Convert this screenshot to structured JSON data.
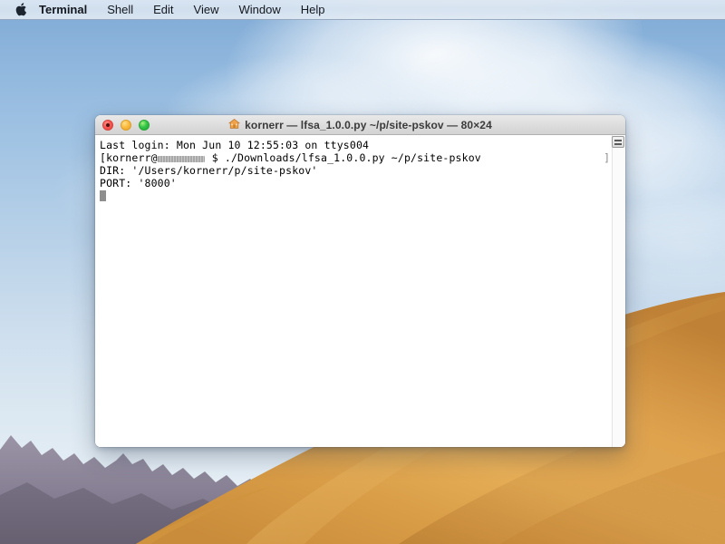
{
  "menubar": {
    "apple_icon": "apple-logo-icon",
    "items": [
      {
        "label": "Terminal",
        "bold": true
      },
      {
        "label": "Shell",
        "bold": false
      },
      {
        "label": "Edit",
        "bold": false
      },
      {
        "label": "View",
        "bold": false
      },
      {
        "label": "Window",
        "bold": false
      },
      {
        "label": "Help",
        "bold": false
      }
    ]
  },
  "window": {
    "title": "kornerr — lfsa_1.0.0.py ~/p/site-pskov — 80×24",
    "title_icon": "home-folder-icon",
    "controls": {
      "close_label": "Close",
      "minimize_label": "Minimize",
      "zoom_label": "Zoom"
    },
    "columns": "80",
    "rows": "24"
  },
  "terminal": {
    "line1": "Last login: Mon Jun 10 12:55:03 on ttys004",
    "line2_prefix": "[kornerr@",
    "line2_hostname_redacted": true,
    "line2_suffix": " $ ./Downloads/lfsa_1.0.0.py ~/p/site-pskov",
    "line2_wrap_bracket": "]",
    "line3": "DIR: '/Users/kornerr/p/site-pskov'",
    "line4": "PORT: '8000'",
    "cursor": "block",
    "scroll_button_icon": "list-lines-icon"
  },
  "colors": {
    "menubar_bg": "#dee8f3",
    "terminal_bg": "#ffffff",
    "terminal_fg": "#000000",
    "titlebar_bg": "#dedede",
    "traffic_close": "#fc5753",
    "traffic_minimize": "#fdbc40",
    "traffic_zoom": "#33c748",
    "sky_top": "#7fa9d4",
    "dune_gold": "#e0a94e",
    "mountain_gray": "#8b8598"
  }
}
